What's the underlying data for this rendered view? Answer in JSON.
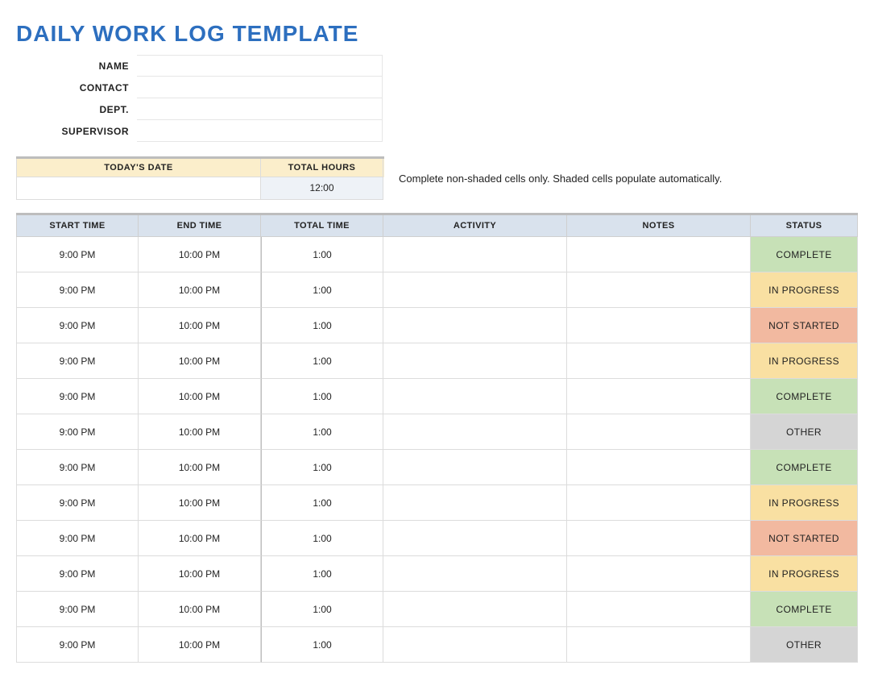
{
  "title": "DAILY WORK LOG TEMPLATE",
  "info": {
    "labels": {
      "name": "NAME",
      "contact": "CONTACT",
      "dept": "DEPT.",
      "supervisor": "SUPERVISOR"
    },
    "values": {
      "name": "",
      "contact": "",
      "dept": "",
      "supervisor": ""
    }
  },
  "summary": {
    "headers": {
      "date": "TODAY'S DATE",
      "hours": "TOTAL HOURS"
    },
    "date": "",
    "total_hours": "12:00"
  },
  "instructions": "Complete non-shaded cells only. Shaded cells populate automatically.",
  "table": {
    "headers": {
      "start": "START TIME",
      "end": "END TIME",
      "total": "TOTAL TIME",
      "activity": "ACTIVITY",
      "notes": "NOTES",
      "status": "STATUS"
    }
  },
  "status_styles": {
    "COMPLETE": "status-complete",
    "IN PROGRESS": "status-in-progress",
    "NOT STARTED": "status-not-started",
    "OTHER": "status-other"
  },
  "rows": [
    {
      "start": "9:00 PM",
      "end": "10:00 PM",
      "total": "1:00",
      "activity": "",
      "notes": "",
      "status": "COMPLETE"
    },
    {
      "start": "9:00 PM",
      "end": "10:00 PM",
      "total": "1:00",
      "activity": "",
      "notes": "",
      "status": "IN PROGRESS"
    },
    {
      "start": "9:00 PM",
      "end": "10:00 PM",
      "total": "1:00",
      "activity": "",
      "notes": "",
      "status": "NOT STARTED"
    },
    {
      "start": "9:00 PM",
      "end": "10:00 PM",
      "total": "1:00",
      "activity": "",
      "notes": "",
      "status": "IN PROGRESS"
    },
    {
      "start": "9:00 PM",
      "end": "10:00 PM",
      "total": "1:00",
      "activity": "",
      "notes": "",
      "status": "COMPLETE"
    },
    {
      "start": "9:00 PM",
      "end": "10:00 PM",
      "total": "1:00",
      "activity": "",
      "notes": "",
      "status": "OTHER"
    },
    {
      "start": "9:00 PM",
      "end": "10:00 PM",
      "total": "1:00",
      "activity": "",
      "notes": "",
      "status": "COMPLETE"
    },
    {
      "start": "9:00 PM",
      "end": "10:00 PM",
      "total": "1:00",
      "activity": "",
      "notes": "",
      "status": "IN PROGRESS"
    },
    {
      "start": "9:00 PM",
      "end": "10:00 PM",
      "total": "1:00",
      "activity": "",
      "notes": "",
      "status": "NOT STARTED"
    },
    {
      "start": "9:00 PM",
      "end": "10:00 PM",
      "total": "1:00",
      "activity": "",
      "notes": "",
      "status": "IN PROGRESS"
    },
    {
      "start": "9:00 PM",
      "end": "10:00 PM",
      "total": "1:00",
      "activity": "",
      "notes": "",
      "status": "COMPLETE"
    },
    {
      "start": "9:00 PM",
      "end": "10:00 PM",
      "total": "1:00",
      "activity": "",
      "notes": "",
      "status": "OTHER"
    }
  ]
}
